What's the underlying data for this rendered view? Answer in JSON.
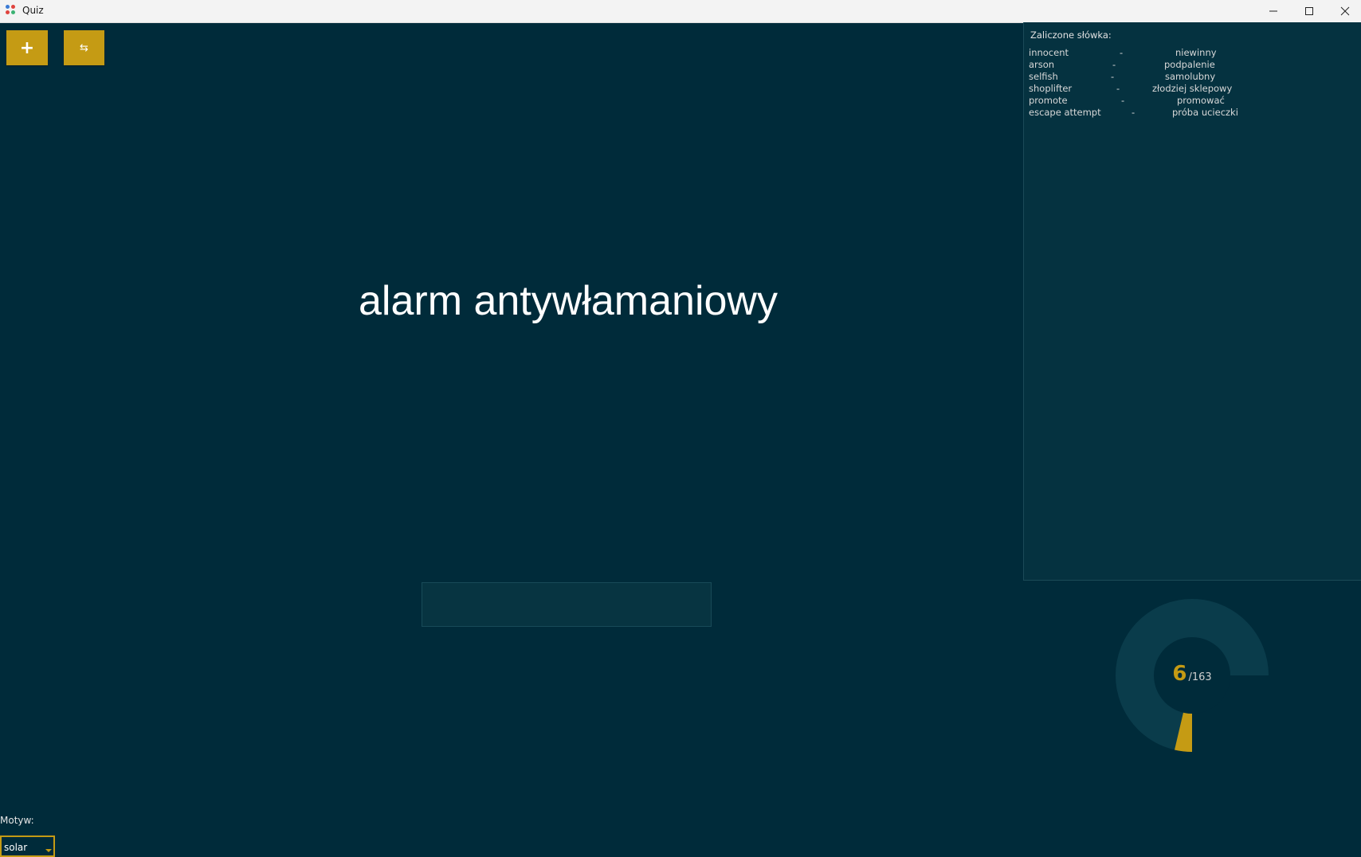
{
  "window": {
    "title": "Quiz",
    "icons": {
      "app": "app-dots-icon",
      "minimize": "minimize-icon",
      "maximize": "maximize-icon",
      "close": "close-icon"
    }
  },
  "toolbar": {
    "add_label": "+",
    "swap_label": "⇆"
  },
  "quiz": {
    "question": "alarm antywłamaniowy",
    "answer_value": "",
    "answer_placeholder": ""
  },
  "passed": {
    "title": "Zaliczone słówka:",
    "items": [
      {
        "word": "innocent",
        "sep": "-",
        "translation": "niewinny"
      },
      {
        "word": "arson",
        "sep": "-",
        "translation": "podpalenie"
      },
      {
        "word": "selfish",
        "sep": "-",
        "translation": "samolubny"
      },
      {
        "word": "shoplifter",
        "sep": "-",
        "translation": "złodziej sklepowy"
      },
      {
        "word": "promote",
        "sep": "-",
        "translation": "promować"
      },
      {
        "word": "escape attempt",
        "sep": "-",
        "translation": "próba ucieczki"
      }
    ]
  },
  "progress": {
    "done": "6",
    "total": "/163",
    "fraction": 0.0368
  },
  "theme": {
    "label": "Motyw:",
    "selected": "solar"
  },
  "colors": {
    "background": "#002b3a",
    "panel": "#053240",
    "accent": "#c59b14",
    "ring_track": "#0a3c4b",
    "text": "#ffffff"
  }
}
